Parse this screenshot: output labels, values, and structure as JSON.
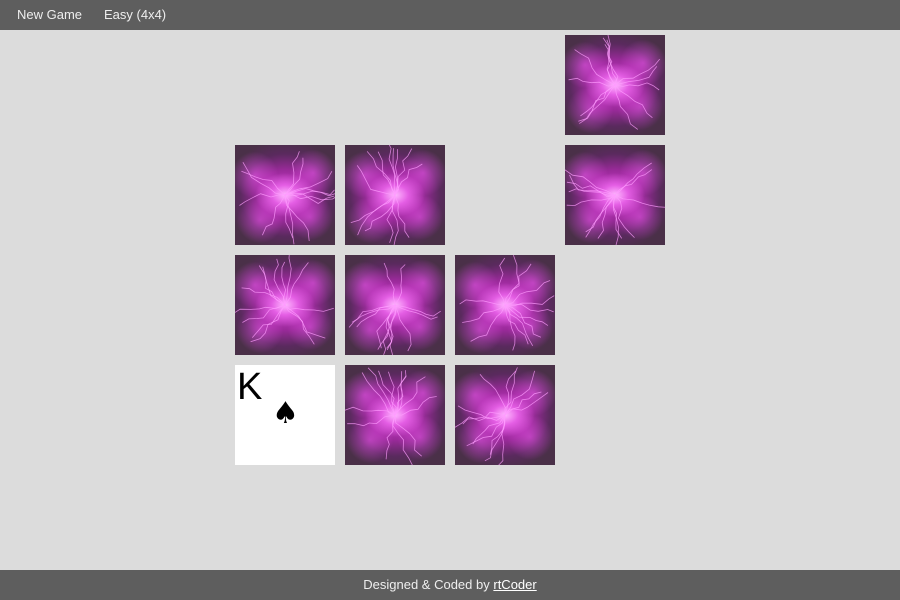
{
  "menu": {
    "new_game": "New Game",
    "difficulty": "Easy (4x4)"
  },
  "board": {
    "columns": 4,
    "rows": 4,
    "cards": [
      {
        "row": 0,
        "col": 3,
        "state": "face-down"
      },
      {
        "row": 1,
        "col": 0,
        "state": "face-down"
      },
      {
        "row": 1,
        "col": 1,
        "state": "face-down"
      },
      {
        "row": 1,
        "col": 3,
        "state": "face-down"
      },
      {
        "row": 2,
        "col": 0,
        "state": "face-down"
      },
      {
        "row": 2,
        "col": 1,
        "state": "face-down"
      },
      {
        "row": 2,
        "col": 2,
        "state": "face-down"
      },
      {
        "row": 3,
        "col": 0,
        "state": "face-up",
        "rank": "K",
        "suit": "♠"
      },
      {
        "row": 3,
        "col": 1,
        "state": "face-down"
      },
      {
        "row": 3,
        "col": 2,
        "state": "face-down"
      }
    ],
    "card_back": "purple-fractal-pattern"
  },
  "footer": {
    "prefix": "Designed & Coded by ",
    "author_link": "rtCoder"
  }
}
